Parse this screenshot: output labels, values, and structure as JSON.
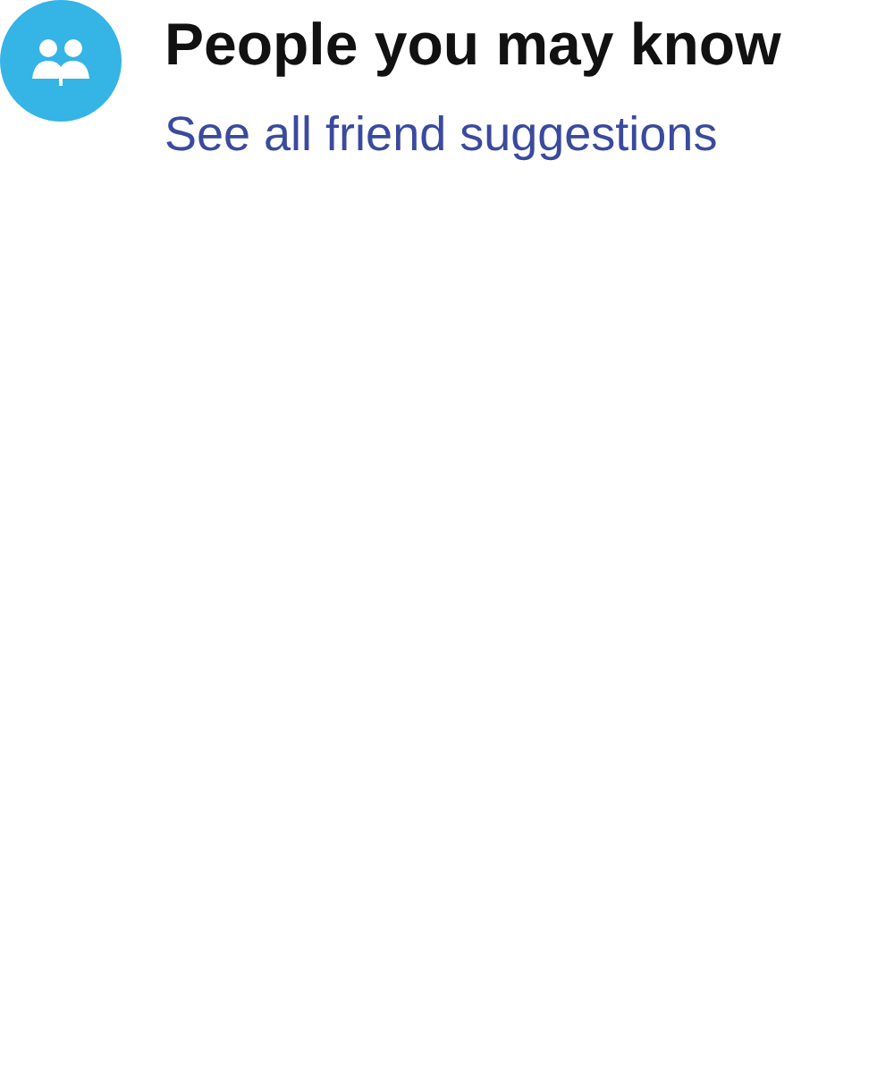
{
  "header": {
    "title": "People you may know",
    "link": "See all friend suggestions"
  }
}
